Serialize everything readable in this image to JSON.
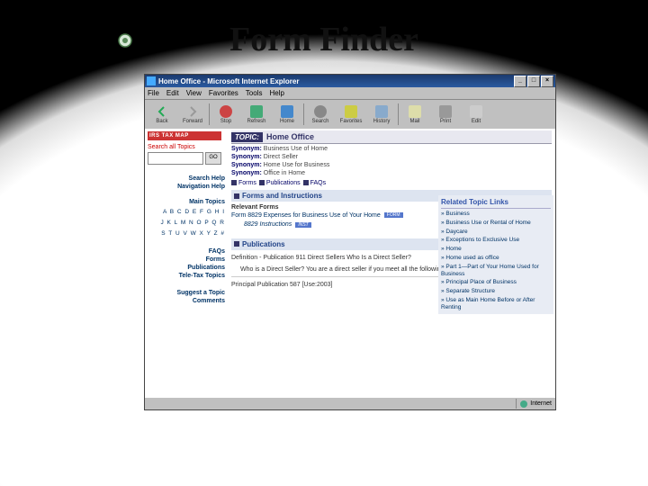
{
  "slide_title": "Form Finder",
  "window": {
    "title": "Home Office - Microsoft Internet Explorer",
    "buttons": {
      "min": "_",
      "max": "□",
      "close": "×"
    }
  },
  "menubar": [
    "File",
    "Edit",
    "View",
    "Favorites",
    "Tools",
    "Help"
  ],
  "toolbar": {
    "back": "Back",
    "forward": "Forward",
    "stop": "Stop",
    "refresh": "Refresh",
    "home": "Home",
    "search": "Search",
    "favorites": "Favorites",
    "history": "History",
    "mail": "Mail",
    "print": "Print",
    "edit": "Edit"
  },
  "sidebar": {
    "logo": "IRS TAX MAP",
    "search_label": "Search all Topics",
    "go": "GO",
    "links": {
      "search_help": "Search Help",
      "nav_help": "Navigation Help"
    },
    "main_topics_hdr": "Main Topics",
    "alpha1": "A B C D E F G H I",
    "alpha2": "J K L M N O P Q R",
    "alpha3": "S T U V W X Y Z #",
    "nav": {
      "faqs": "FAQs",
      "forms": "Forms",
      "pubs": "Publications",
      "tele": "Tele-Tax Topics"
    },
    "suggest": "Suggest a Topic",
    "comments": "Comments"
  },
  "topic": {
    "label": "TOPIC:",
    "value": "Home Office",
    "syn1_k": "Synonym:",
    "syn1_v": "Business Use of Home",
    "syn2_k": "Synonym:",
    "syn2_v": "Direct Seller",
    "syn3_k": "Synonym:",
    "syn3_v": "Home Use for Business",
    "syn4_k": "Synonym:",
    "syn4_v": "Office in Home"
  },
  "tabs": {
    "forms": "Forms",
    "pubs": "Publications",
    "faqs": "FAQs"
  },
  "sections": {
    "forms_hdr": "Forms and Instructions",
    "relevant": "Relevant Forms",
    "form1": "Form 8829 Expenses for Business Use of Your Home",
    "form1_tag": "FORM",
    "form1_inst": "8829 Instructions",
    "form1_inst_tag": "INST",
    "pubs_hdr": "Publications",
    "pub_def": "Definition - Publication 911 Direct Sellers Who Is a Direct Seller?",
    "pub_body": "Who is a Direct Seller? You are a direct seller if you meet all the following...",
    "principal": "Principal Publication 587 [Use:2003]"
  },
  "related": {
    "hdr": "Related Topic Links",
    "items": [
      "» Business",
      "» Business Use or Rental of Home",
      "» Daycare",
      "» Exceptions to Exclusive Use",
      "» Home",
      "» Home used as office",
      "» Part 1—Part of Your Home Used for Business",
      "» Principal Place of Business",
      "» Separate Structure",
      "» Use as Main Home Before or After Renting"
    ]
  },
  "status": {
    "zone": "Internet"
  }
}
